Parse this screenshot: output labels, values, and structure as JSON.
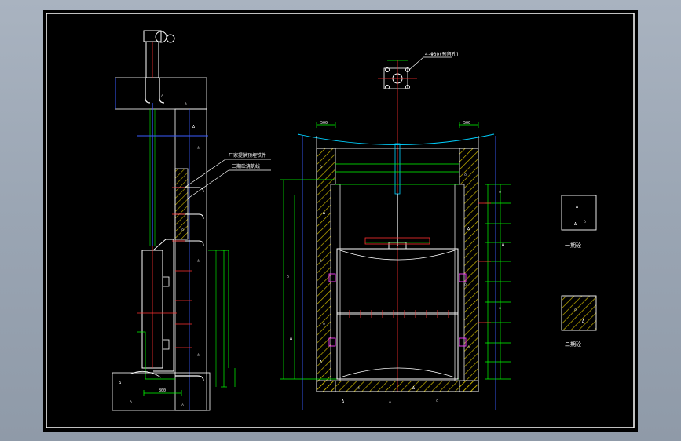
{
  "drawing": {
    "callouts": [
      "厂家提供预埋铁件",
      "二期砼浇筑线"
    ],
    "bolt_note": "4-Φ30(预留孔)",
    "dim_left": "500",
    "dim_right": "500",
    "dim_base": "800",
    "legend": {
      "first_stage": "一期砼",
      "second_stage": "二期砼"
    }
  },
  "colors": {
    "frame": "#ffffff",
    "steel": "#ffffff",
    "concrete_hatch": "#c8b400",
    "dimension": "#00ff00",
    "center_line": "#ff3030",
    "water_line": "#00d0ff",
    "guide_line": "#3a5cff",
    "stage_mark": "#ff40ff"
  }
}
